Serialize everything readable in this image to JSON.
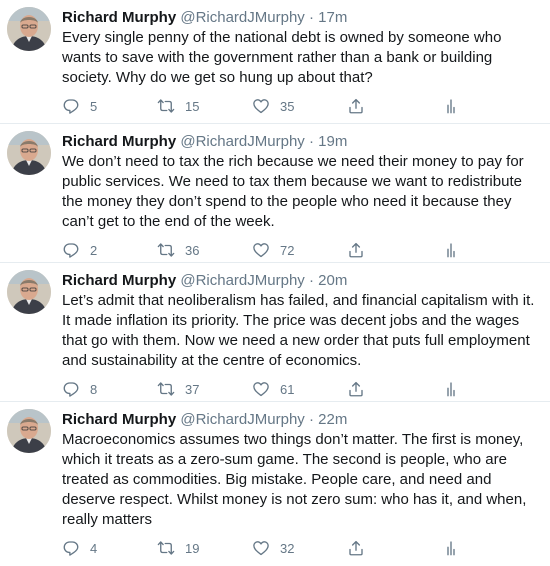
{
  "tweets": [
    {
      "name": "Richard Murphy",
      "handle": "@RichardJMurphy",
      "separator": "·",
      "time": "17m",
      "text": "Every single penny of the national debt is owned by someone who wants to save with the government rather than a bank or building society. Why do we get so hung up about that?",
      "replies": "5",
      "retweets": "15",
      "likes": "35"
    },
    {
      "name": "Richard Murphy",
      "handle": "@RichardJMurphy",
      "separator": "·",
      "time": "19m",
      "text": "We don’t need to tax the rich because we need their money to pay for public services. We need to tax them because we want to redistribute the money they don’t spend to the people who need it because they can’t get to the end of the week.",
      "replies": "2",
      "retweets": "36",
      "likes": "72"
    },
    {
      "name": "Richard Murphy",
      "handle": "@RichardJMurphy",
      "separator": "·",
      "time": "20m",
      "text": "Let’s admit that neoliberalism has failed, and financial  capitalism with it. It made inflation its priority. The price was decent jobs and the wages that go with them. Now we need a new order that puts full employment and sustainability at the centre of economics.",
      "replies": "8",
      "retweets": "37",
      "likes": "61"
    },
    {
      "name": "Richard Murphy",
      "handle": "@RichardJMurphy",
      "separator": "·",
      "time": "22m",
      "text": "Macroeconomics assumes two things don’t matter. The first is money, which it treats as a zero-sum game. The second is people, who are treated as commodities. Big mistake. People care, and need and deserve respect. Whilst money is not zero sum: who has it, and when, really matters",
      "replies": "4",
      "retweets": "19",
      "likes": "32"
    }
  ],
  "icons": {
    "reply": "reply-icon",
    "retweet": "retweet-icon",
    "like": "like-icon",
    "share": "share-icon",
    "analytics": "analytics-icon"
  },
  "colors": {
    "text": "#14171a",
    "secondary": "#657786",
    "divider": "#e6ecf0"
  }
}
